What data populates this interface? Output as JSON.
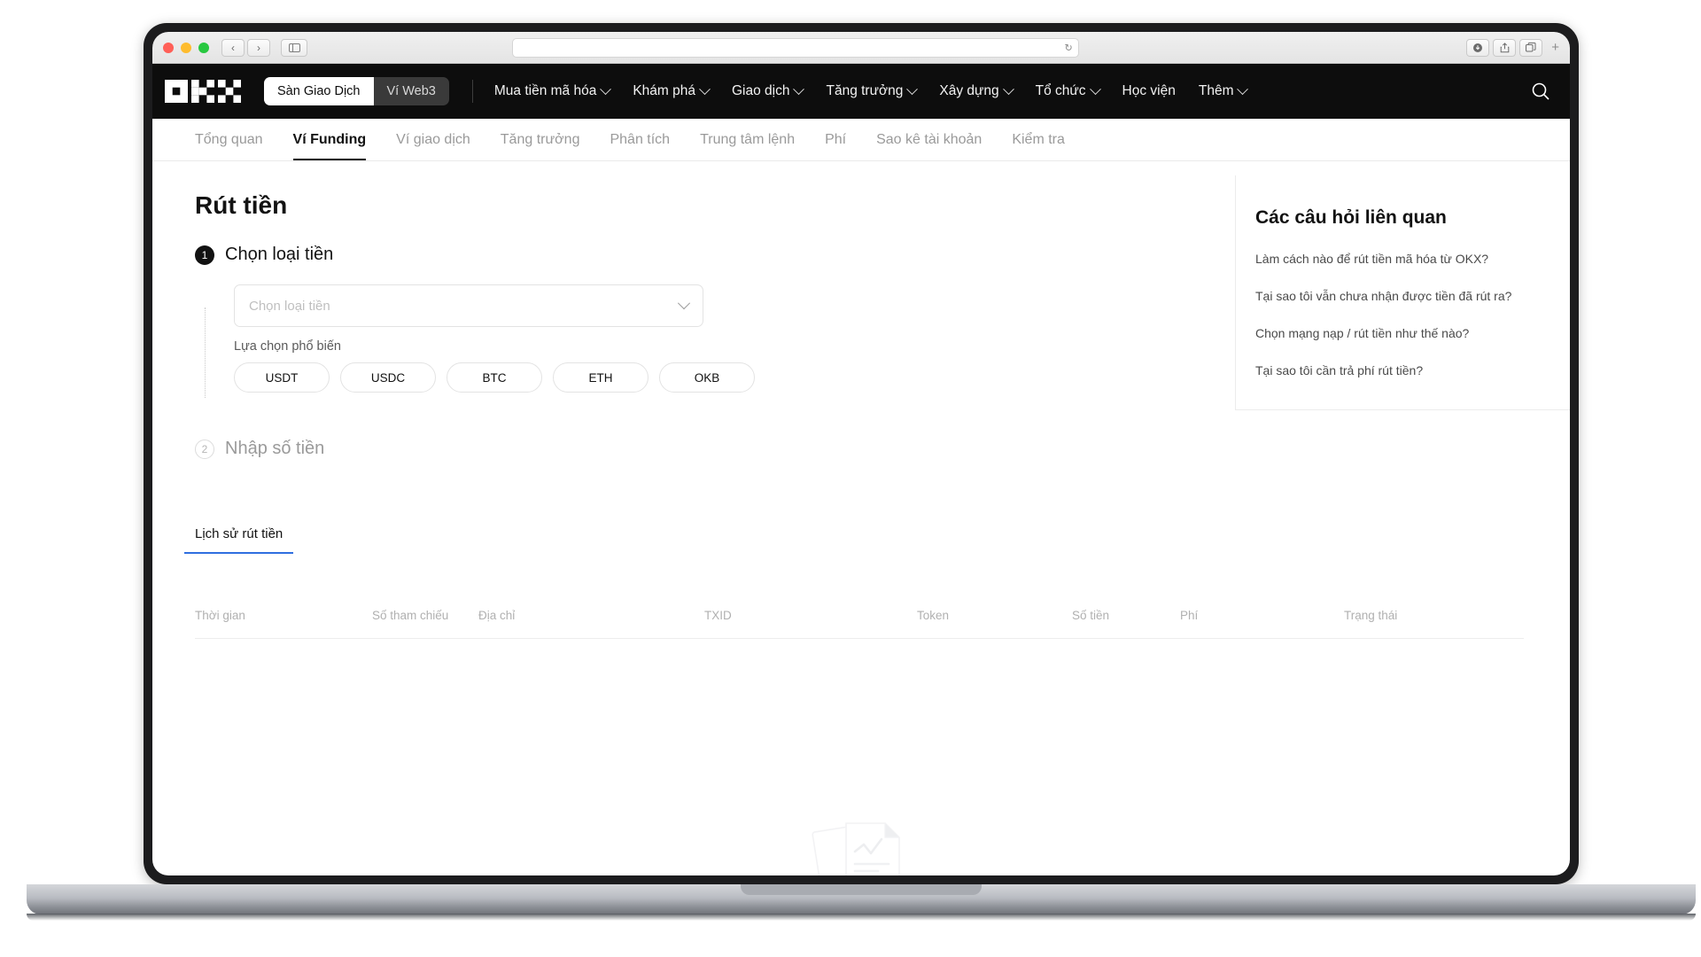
{
  "browser": {
    "back_icon": "chevron-left-icon",
    "forward_icon": "chevron-right-icon",
    "sidebar_icon": "sidebar-toggle-icon",
    "reload_symbol": "↻",
    "url_value": "",
    "url_placeholder": "",
    "downloads_symbol": "⬇",
    "share_symbol": "⤴",
    "tabs_symbol": "⧉",
    "new_tab_symbol": "+"
  },
  "topnav": {
    "logo_name": "OKX",
    "segmented": [
      {
        "label": "Sàn Giao Dịch",
        "active": true
      },
      {
        "label": "Ví Web3",
        "active": false
      }
    ],
    "links": [
      {
        "label": "Mua tiền mã hóa",
        "caret": true
      },
      {
        "label": "Khám phá",
        "caret": true
      },
      {
        "label": "Giao dịch",
        "caret": true
      },
      {
        "label": "Tăng trưởng",
        "caret": true
      },
      {
        "label": "Xây dựng",
        "caret": true
      },
      {
        "label": "Tổ chức",
        "caret": true
      },
      {
        "label": "Học viện",
        "caret": false
      },
      {
        "label": "Thêm",
        "caret": true
      }
    ],
    "search_icon": "search-icon"
  },
  "subnav": {
    "items": [
      {
        "label": "Tổng quan",
        "active": false
      },
      {
        "label": "Ví Funding",
        "active": true
      },
      {
        "label": "Ví giao dịch",
        "active": false
      },
      {
        "label": "Tăng trưởng",
        "active": false
      },
      {
        "label": "Phân tích",
        "active": false
      },
      {
        "label": "Trung tâm lệnh",
        "active": false
      },
      {
        "label": "Phí",
        "active": false
      },
      {
        "label": "Sao kê tài khoản",
        "active": false
      },
      {
        "label": "Kiểm tra",
        "active": false
      }
    ]
  },
  "main": {
    "page_title": "Rút tiền",
    "step1": {
      "number": "1",
      "title": "Chọn loại tiền",
      "select_placeholder": "Chọn loại tiền",
      "select_value": "",
      "popular_label": "Lựa chọn phổ biến",
      "chips": [
        "USDT",
        "USDC",
        "BTC",
        "ETH",
        "OKB"
      ]
    },
    "step2": {
      "number": "2",
      "title": "Nhập số tiền"
    }
  },
  "faq": {
    "title": "Các câu hỏi liên quan",
    "items": [
      "Làm cách nào để rút tiền mã hóa từ OKX?",
      "Tại sao tôi vẫn chưa nhận được tiền đã rút ra?",
      "Chọn mạng nạp / rút tiền như thế nào?",
      "Tại sao tôi cần trả phí rút tiền?"
    ]
  },
  "history": {
    "tabs": [
      {
        "label": "Lịch sử rút tiền",
        "active": true
      }
    ],
    "columns": [
      "Thời gian",
      "Số tham chiếu",
      "Địa chỉ",
      "TXID",
      "Token",
      "Số tiền",
      "Phí",
      "Trạng thái"
    ],
    "rows": []
  },
  "colors": {
    "nav_bg": "#0d0d0d",
    "accent_blue": "#2f6fe0",
    "text_primary": "#121212",
    "text_muted": "#9a9a9a",
    "border": "#e3e3e3"
  }
}
